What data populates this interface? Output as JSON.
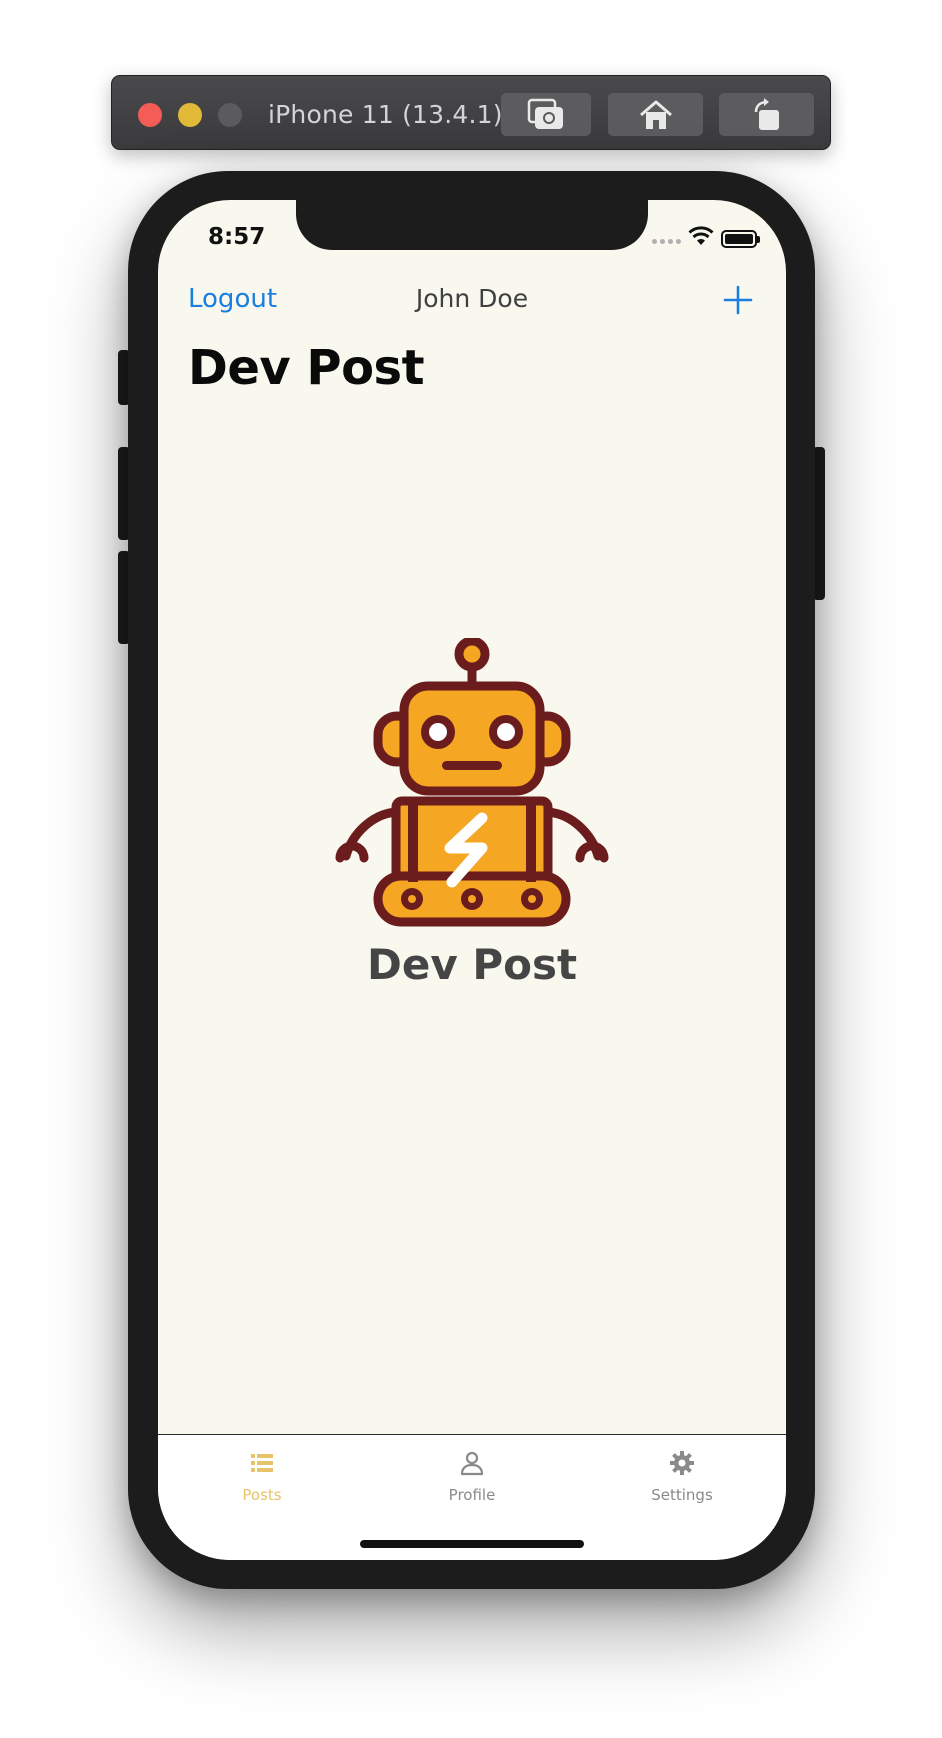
{
  "simulator": {
    "title": "iPhone 11 (13.4.1)",
    "buttons": [
      {
        "icon": "screenshot-icon"
      },
      {
        "icon": "home-icon"
      },
      {
        "icon": "rotate-icon"
      }
    ]
  },
  "status_bar": {
    "time": "8:57"
  },
  "nav": {
    "left_label": "Logout",
    "title": "John Doe",
    "right_icon": "plus-icon"
  },
  "page": {
    "large_title": "Dev Post"
  },
  "logo": {
    "icon": "robot-icon",
    "text": "Dev Post"
  },
  "tabbar": {
    "tabs": [
      {
        "label": "Posts",
        "icon": "list-icon",
        "selected": true
      },
      {
        "label": "Profile",
        "icon": "person-icon",
        "selected": false
      },
      {
        "label": "Settings",
        "icon": "gear-icon",
        "selected": false
      }
    ]
  },
  "colors": {
    "accent": "#1a7fe0",
    "tab_selected": "#e8c36a",
    "robot_body": "#f5a623",
    "robot_outline": "#6b1c1c",
    "background": "#f9f8ee"
  }
}
